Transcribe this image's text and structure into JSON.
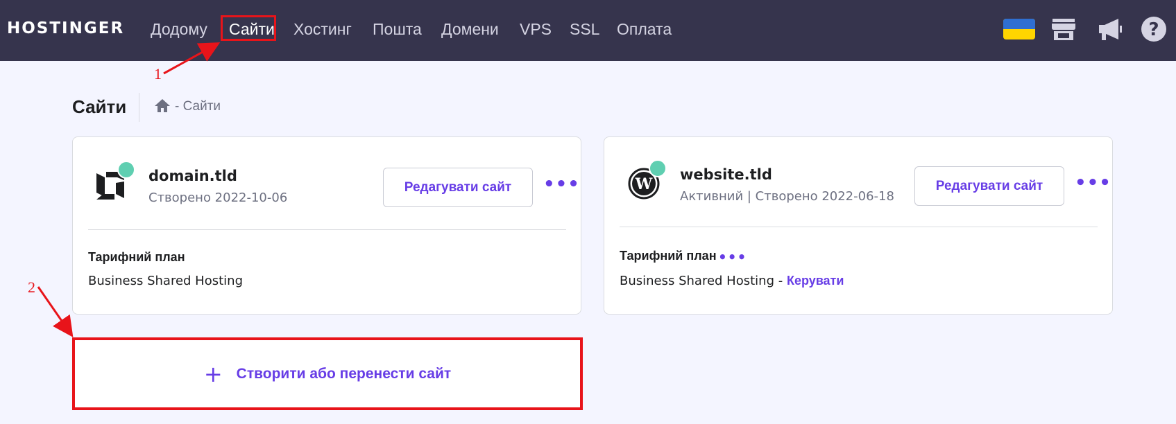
{
  "nav": {
    "logo": "HOSTINGER",
    "items": [
      {
        "label": "Додому"
      },
      {
        "label": "Сайти"
      },
      {
        "label": "Хостинг"
      },
      {
        "label": "Пошта"
      },
      {
        "label": "Домени"
      },
      {
        "label": "VPS"
      },
      {
        "label": "SSL"
      },
      {
        "label": "Оплата"
      }
    ],
    "active_item": "Сайти",
    "icons": [
      "ukraine-flag-icon",
      "store-icon",
      "megaphone-icon",
      "help-icon"
    ],
    "flag_colors": {
      "top": "#2f6fd1",
      "bottom": "#ffd500"
    }
  },
  "annotations": {
    "marker1": "1",
    "marker2": "2",
    "color": "#e8141a"
  },
  "page": {
    "title": "Сайти",
    "breadcrumb": "- Сайти"
  },
  "sites": [
    {
      "domain": "domain.tld",
      "meta": "Створено 2022-10-06",
      "edit_label": "Редагувати сайт",
      "plan_label": "Тарифний план",
      "plan_value": "Business Shared Hosting",
      "icon": "hostinger-logo-icon"
    },
    {
      "domain": "website.tld",
      "meta": "Активний | Створено 2022-06-18",
      "edit_label": "Редагувати сайт",
      "plan_label": "Тарифний план",
      "plan_value": "Business Shared Hosting - ",
      "manage_label": "Керувати",
      "icon": "wordpress-icon"
    }
  ],
  "create": {
    "label": "Створити або перенести сайт"
  },
  "colors": {
    "accent": "#673de6",
    "nav_bg": "#36344d",
    "page_bg": "#f4f5ff",
    "status_dot": "#5fcfb1"
  }
}
